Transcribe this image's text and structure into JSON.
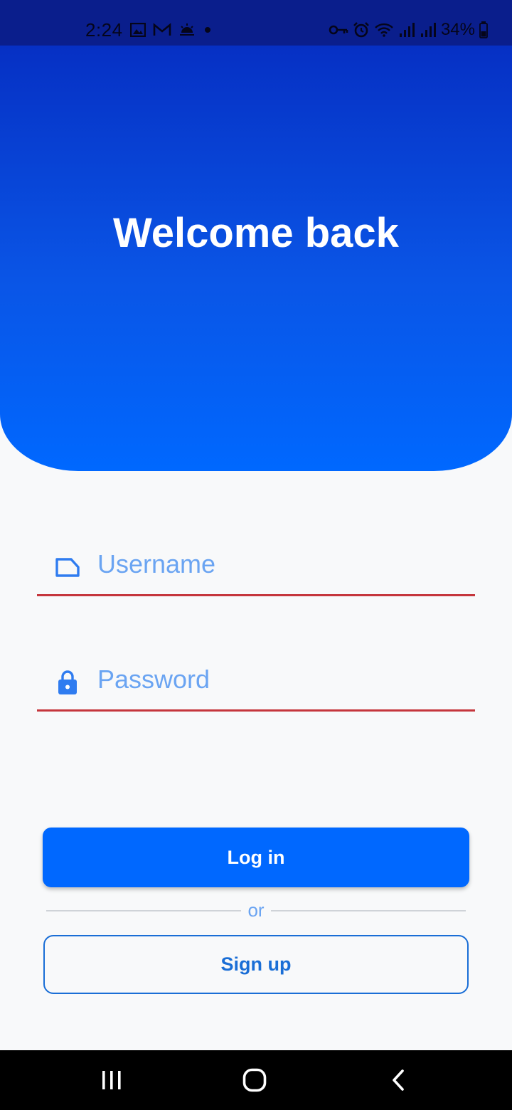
{
  "status_bar": {
    "time": "2:24",
    "battery": "34%",
    "left_icons": [
      "gallery-icon",
      "gmail-icon",
      "weather-icon",
      "dot-icon"
    ],
    "right_icons": [
      "vpn-key-icon",
      "alarm-icon",
      "wifi-icon",
      "signal-icon",
      "signal-icon",
      "battery-icon"
    ]
  },
  "header": {
    "title": "Welcome back"
  },
  "form": {
    "username": {
      "placeholder": "Username",
      "icon": "label-icon"
    },
    "password": {
      "placeholder": "Password",
      "icon": "lock-icon"
    }
  },
  "actions": {
    "login_label": "Log in",
    "divider_label": "or",
    "signup_label": "Sign up"
  },
  "nav_bar": {
    "buttons": [
      "recents-icon",
      "home-icon",
      "back-icon"
    ]
  },
  "colors": {
    "primary": "#0068ff",
    "header_top": "#0630c4",
    "placeholder": "#6aa4f2",
    "error_underline": "#c5363c",
    "outline": "#1a6ed6"
  }
}
